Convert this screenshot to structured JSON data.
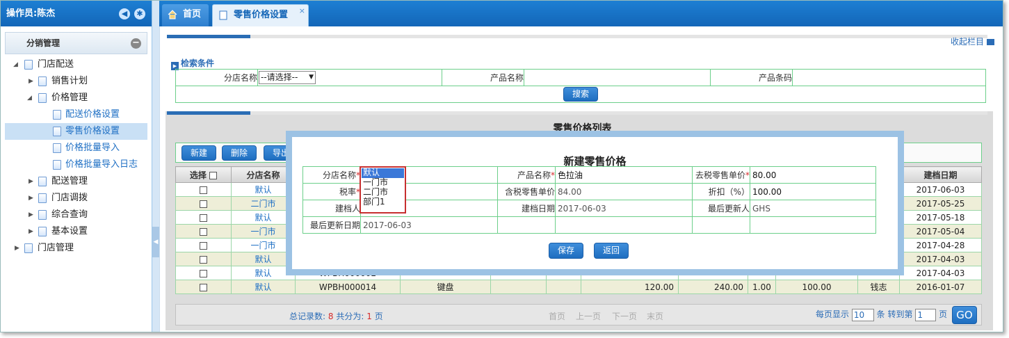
{
  "user": {
    "label": "操作员:陈杰"
  },
  "sidebar": {
    "panel_title": "分销管理",
    "items": [
      {
        "label": "门店配送"
      },
      {
        "label": "销售计划"
      },
      {
        "label": "价格管理"
      },
      {
        "label": "配送价格设置"
      },
      {
        "label": "零售价格设置"
      },
      {
        "label": "价格批量导入"
      },
      {
        "label": "价格批量导入日志"
      },
      {
        "label": "配送管理"
      },
      {
        "label": "门店调拨"
      },
      {
        "label": "综合查询"
      },
      {
        "label": "基本设置"
      },
      {
        "label": "门店管理"
      }
    ]
  },
  "tabs": [
    {
      "label": "首页"
    },
    {
      "label": "零售价格设置"
    }
  ],
  "collapse_label": "收起栏目",
  "search": {
    "title": "检索条件",
    "store_label": "分店名称",
    "store_select": "--请选择--",
    "product_label": "产品名称",
    "barcode_label": "产品条码",
    "search_button": "搜索"
  },
  "list": {
    "title": "零售价格列表",
    "buttons": {
      "new": "新建",
      "delete": "删除",
      "export": "导出"
    },
    "col_select": "选择",
    "col_store": "分店名称",
    "col_date": "建档日期",
    "rows": [
      {
        "store": "默认",
        "date": "2017-06-03"
      },
      {
        "store": "二门市",
        "date": "2017-05-25"
      },
      {
        "store": "默认",
        "date": "2017-05-18"
      },
      {
        "store": "一门市",
        "date": "2017-05-04"
      },
      {
        "store": "一门市",
        "date": "2017-04-28"
      },
      {
        "store": "默认",
        "date": "2017-04-03"
      },
      {
        "store": "默认",
        "code": "WPBH000002",
        "date": "2017-04-03"
      },
      {
        "store": "默认",
        "code": "WPBH000014",
        "name": "键盘",
        "price1": "120.00",
        "price2": "240.00",
        "rate": "1.00",
        "discount": "100.00",
        "person": "钱志",
        "date": "2016-01-07"
      }
    ]
  },
  "pager": {
    "total_label": "总记录数:",
    "total": "8",
    "pages_label": "共分为:",
    "pages": "1",
    "page_unit": "页",
    "first": "首页",
    "prev": "上一页",
    "next": "下一页",
    "last": "末页",
    "per_page_label": "每页显示",
    "per_page": "10",
    "goto_label": "条 转到第",
    "goto_value": "1",
    "page_suffix": "页",
    "go": "GO"
  },
  "dialog": {
    "title": "新建零售价格",
    "store_label": "分店名称",
    "store_value": "默认",
    "product_label": "产品名称",
    "product_value": "色拉油",
    "pretax_label": "去税零售单价",
    "pretax_value": "80.00",
    "tax_label": "税率",
    "taxed_label": "含税零售单价",
    "taxed_value": "84.00",
    "discount_label": "折扣（%）",
    "discount_value": "100.00",
    "creator_label": "建档人",
    "create_date_label": "建档日期",
    "create_date_value": "2017-06-03",
    "updater_label": "最后更新人",
    "updater_value": "GHS",
    "update_date_label": "最后更新日期",
    "update_date_value": "2017-06-03",
    "save": "保存",
    "back": "返回",
    "options": [
      "默认",
      "一门市",
      "二门市",
      "部门1"
    ]
  },
  "colors": {
    "header_blue": "#1366b8",
    "accent_red": "#d52b2b",
    "grid_green": "#6ccf8a"
  }
}
